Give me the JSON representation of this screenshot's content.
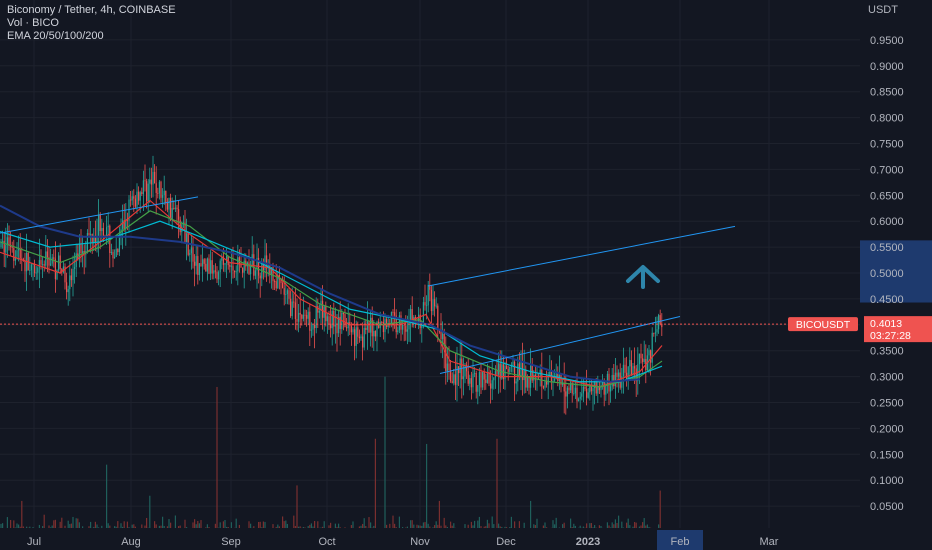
{
  "legend": {
    "line1": "Biconomy / Tether, 4h, COINBASE",
    "line2": "Vol · BICO",
    "line3": "EMA 20/50/100/200"
  },
  "currency_label": "USDT",
  "colors": {
    "background": "#131722",
    "grid": "#1e222d",
    "up": "#26a69a",
    "down": "#ef5350",
    "ema20": "#e53935",
    "ema50": "#43a047",
    "ema100": "#00bcd4",
    "ema200": "#1e3a8a",
    "trendline": "#2196f3",
    "price_line": "#ef5350",
    "arrow": "#2e86ab",
    "highlight": "#1e3a6e"
  },
  "chart_data": {
    "type": "candlestick",
    "title": "Biconomy / Tether, 4h, COINBASE",
    "ylim": [
      0,
      1.0
    ],
    "y_ticks": [
      "0.0500",
      "0.1000",
      "0.1500",
      "0.2000",
      "0.2500",
      "0.3000",
      "0.3500",
      "0.4000",
      "0.4500",
      "0.5000",
      "0.5500",
      "0.6000",
      "0.6500",
      "0.7000",
      "0.7500",
      "0.8000",
      "0.8500",
      "0.9000",
      "0.9500"
    ],
    "x_ticks": [
      "Jul",
      "Aug",
      "Sep",
      "Oct",
      "Nov",
      "Dec",
      "2023",
      "Feb",
      "Mar"
    ],
    "highlighted_x_tick": "Feb",
    "last_price": {
      "symbol": "BICOUSDT",
      "price": "0.4013",
      "countdown": "03:27:28",
      "value": 0.4013
    },
    "highlighted_y_range": [
      0.443,
      0.563
    ],
    "price_path": [
      [
        0,
        0.55
      ],
      [
        10,
        0.56
      ],
      [
        22,
        0.53
      ],
      [
        35,
        0.49
      ],
      [
        48,
        0.53
      ],
      [
        60,
        0.51
      ],
      [
        70,
        0.48
      ],
      [
        80,
        0.55
      ],
      [
        90,
        0.57
      ],
      [
        100,
        0.6
      ],
      [
        108,
        0.57
      ],
      [
        115,
        0.52
      ],
      [
        122,
        0.58
      ],
      [
        128,
        0.62
      ],
      [
        134,
        0.64
      ],
      [
        141,
        0.66
      ],
      [
        148,
        0.67
      ],
      [
        155,
        0.67
      ],
      [
        162,
        0.65
      ],
      [
        170,
        0.63
      ],
      [
        178,
        0.61
      ],
      [
        186,
        0.57
      ],
      [
        194,
        0.52
      ],
      [
        202,
        0.51
      ],
      [
        212,
        0.51
      ],
      [
        222,
        0.52
      ],
      [
        232,
        0.51
      ],
      [
        242,
        0.52
      ],
      [
        252,
        0.51
      ],
      [
        262,
        0.52
      ],
      [
        270,
        0.5
      ],
      [
        280,
        0.47
      ],
      [
        290,
        0.44
      ],
      [
        300,
        0.42
      ],
      [
        312,
        0.41
      ],
      [
        322,
        0.42
      ],
      [
        332,
        0.41
      ],
      [
        342,
        0.4
      ],
      [
        352,
        0.39
      ],
      [
        362,
        0.38
      ],
      [
        372,
        0.39
      ],
      [
        382,
        0.4
      ],
      [
        392,
        0.41
      ],
      [
        402,
        0.4
      ],
      [
        412,
        0.41
      ],
      [
        420,
        0.4
      ],
      [
        428,
        0.46
      ],
      [
        434,
        0.43
      ],
      [
        440,
        0.38
      ],
      [
        446,
        0.33
      ],
      [
        452,
        0.3
      ],
      [
        460,
        0.31
      ],
      [
        470,
        0.29
      ],
      [
        480,
        0.3
      ],
      [
        490,
        0.29
      ],
      [
        500,
        0.3
      ],
      [
        510,
        0.31
      ],
      [
        520,
        0.31
      ],
      [
        528,
        0.3
      ],
      [
        536,
        0.32
      ],
      [
        544,
        0.3
      ],
      [
        552,
        0.29
      ],
      [
        560,
        0.28
      ],
      [
        570,
        0.28
      ],
      [
        580,
        0.27
      ],
      [
        590,
        0.28
      ],
      [
        600,
        0.28
      ],
      [
        610,
        0.29
      ],
      [
        620,
        0.3
      ],
      [
        630,
        0.31
      ],
      [
        640,
        0.32
      ],
      [
        648,
        0.34
      ],
      [
        654,
        0.38
      ],
      [
        658,
        0.41
      ],
      [
        662,
        0.4
      ]
    ],
    "emas": {
      "ema20": [
        [
          0,
          0.54
        ],
        [
          60,
          0.5
        ],
        [
          100,
          0.56
        ],
        [
          150,
          0.64
        ],
        [
          186,
          0.58
        ],
        [
          230,
          0.52
        ],
        [
          270,
          0.51
        ],
        [
          300,
          0.45
        ],
        [
          350,
          0.4
        ],
        [
          400,
          0.4
        ],
        [
          426,
          0.42
        ],
        [
          450,
          0.33
        ],
        [
          500,
          0.3
        ],
        [
          550,
          0.3
        ],
        [
          600,
          0.28
        ],
        [
          640,
          0.31
        ],
        [
          662,
          0.36
        ]
      ],
      "ema50": [
        [
          0,
          0.56
        ],
        [
          60,
          0.52
        ],
        [
          100,
          0.55
        ],
        [
          150,
          0.62
        ],
        [
          190,
          0.59
        ],
        [
          230,
          0.53
        ],
        [
          280,
          0.49
        ],
        [
          320,
          0.44
        ],
        [
          380,
          0.4
        ],
        [
          420,
          0.41
        ],
        [
          450,
          0.35
        ],
        [
          500,
          0.31
        ],
        [
          550,
          0.29
        ],
        [
          600,
          0.28
        ],
        [
          640,
          0.3
        ],
        [
          662,
          0.33
        ]
      ],
      "ema100": [
        [
          0,
          0.58
        ],
        [
          50,
          0.55
        ],
        [
          100,
          0.56
        ],
        [
          160,
          0.6
        ],
        [
          200,
          0.57
        ],
        [
          250,
          0.53
        ],
        [
          300,
          0.48
        ],
        [
          350,
          0.43
        ],
        [
          400,
          0.41
        ],
        [
          440,
          0.39
        ],
        [
          480,
          0.34
        ],
        [
          530,
          0.31
        ],
        [
          580,
          0.29
        ],
        [
          620,
          0.29
        ],
        [
          662,
          0.32
        ]
      ],
      "ema200": [
        [
          0,
          0.63
        ],
        [
          40,
          0.59
        ],
        [
          80,
          0.57
        ],
        [
          130,
          0.57
        ],
        [
          180,
          0.56
        ],
        [
          230,
          0.54
        ],
        [
          280,
          0.51
        ],
        [
          330,
          0.46
        ],
        [
          380,
          0.42
        ],
        [
          430,
          0.4
        ],
        [
          470,
          0.36
        ],
        [
          520,
          0.33
        ],
        [
          570,
          0.3
        ],
        [
          610,
          0.29
        ],
        [
          640,
          0.295
        ]
      ]
    },
    "trendlines": [
      [
        [
          0,
          0.577
        ],
        [
          198,
          0.647
        ]
      ],
      [
        [
          428,
          0.475
        ],
        [
          735,
          0.59
        ]
      ],
      [
        [
          440,
          0.306
        ],
        [
          680,
          0.416
        ]
      ]
    ],
    "volume_spikes": [
      [
        22,
        0.06
      ],
      [
        107,
        0.13
      ],
      [
        150,
        0.07
      ],
      [
        217,
        0.28
      ],
      [
        297,
        0.09
      ],
      [
        385,
        0.3
      ],
      [
        375,
        0.18
      ],
      [
        427,
        0.17
      ],
      [
        440,
        0.06
      ],
      [
        497,
        0.18
      ],
      [
        530,
        0.06
      ],
      [
        660,
        0.08
      ]
    ]
  }
}
